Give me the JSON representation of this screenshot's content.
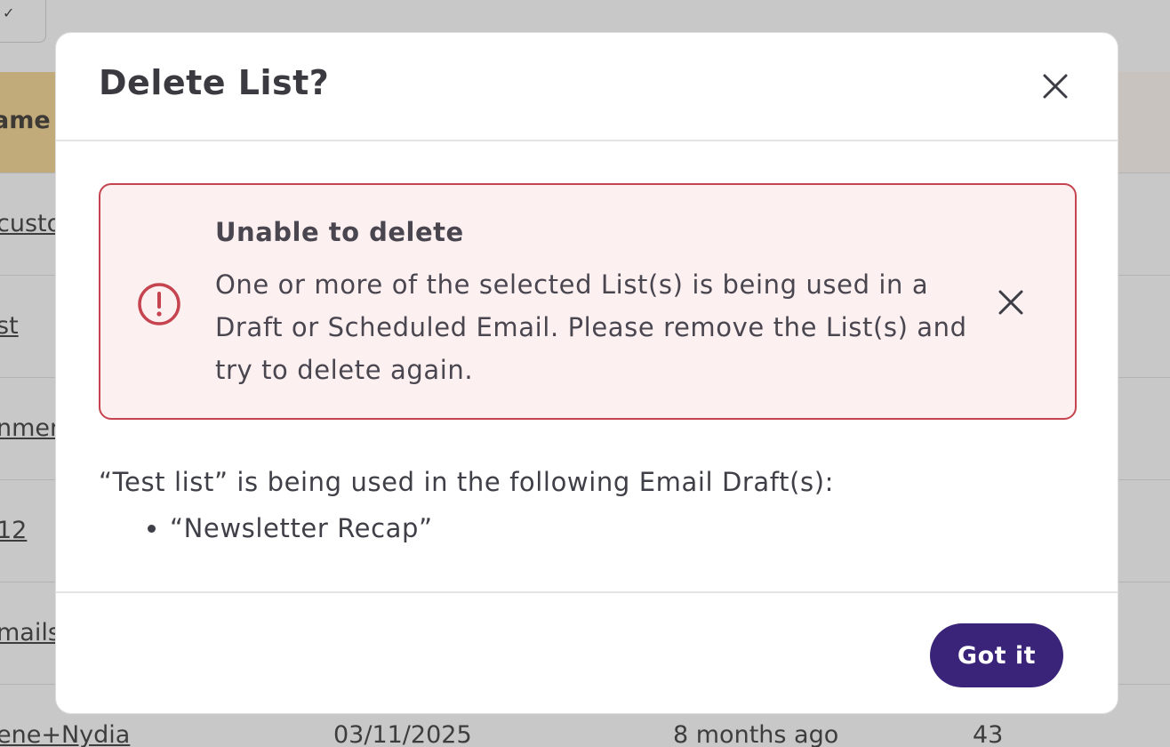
{
  "background": {
    "column_header": "ame",
    "row_links": [
      "custo",
      "st",
      "nmer",
      "12",
      "mails",
      "ene+Nydia"
    ],
    "last_row": {
      "date": "03/11/2025",
      "relative": "8 months ago",
      "count": "43"
    }
  },
  "dialog": {
    "title": "Delete List?",
    "alert": {
      "title": "Unable to delete",
      "body": "One or more of the selected List(s) is being used in a Draft or Scheduled Email. Please remove the List(s) and try to delete again."
    },
    "usage_text": "“Test list” is being used in the following Email Draft(s):",
    "drafts": [
      "“Newsletter Recap”"
    ],
    "confirm_label": "Got it"
  },
  "colors": {
    "primary_button": "#3a2479",
    "alert_border": "#c5444f",
    "alert_background": "#fcf0f0",
    "table_header": "#c2ab7a",
    "overlay": "#c8c8c8"
  }
}
